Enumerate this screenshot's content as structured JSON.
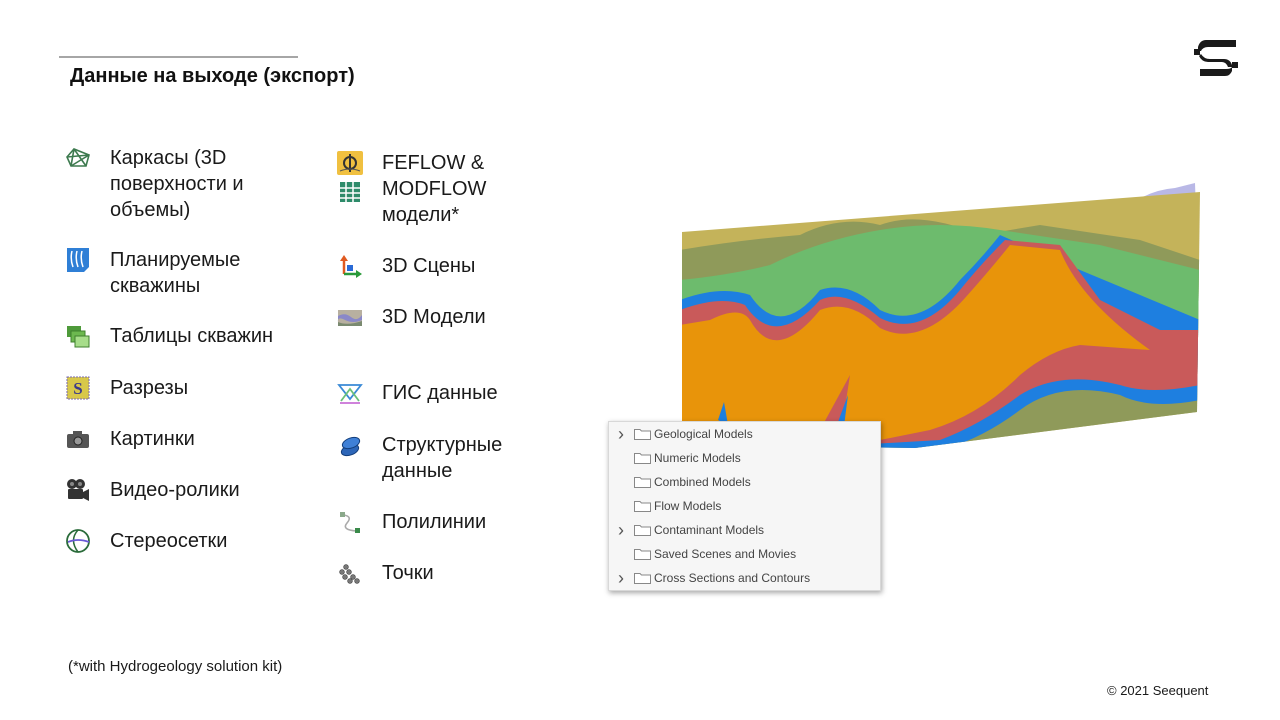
{
  "slide": {
    "title": "Данные на выходе (экспорт)",
    "footnote": "(*with Hydrogeology solution kit)",
    "copyright": "© 2021 Seequent",
    "logo": "seequent-logo"
  },
  "left_column": [
    {
      "icon": "wireframe-icon",
      "label": "Каркасы (3D\nповерхности и\nобъемы)"
    },
    {
      "icon": "planned-boreholes-icon",
      "label": "Планируемые\nскважины"
    },
    {
      "icon": "borehole-tables-icon",
      "label": "Таблицы скважин"
    },
    {
      "icon": "cross-sections-icon",
      "label": "Разрезы"
    },
    {
      "icon": "camera-icon",
      "label": "Картинки"
    },
    {
      "icon": "video-camera-icon",
      "label": "Видео-ролики"
    },
    {
      "icon": "stereonet-icon",
      "label": "Стереосетки"
    }
  ],
  "right_column": [
    {
      "icon": "feflow-modflow-icon",
      "label": "FEFLOW &\nMODFLOW\nмодели*"
    },
    {
      "icon": "3d-scene-axes-icon",
      "label": "3D Сцены"
    },
    {
      "icon": "3d-model-icon",
      "label": "3D Модели"
    },
    {
      "icon": "gis-data-icon",
      "label": "ГИС данные"
    },
    {
      "icon": "structural-data-icon",
      "label": "Структурные\nданные"
    },
    {
      "icon": "polyline-icon",
      "label": "Полилинии"
    },
    {
      "icon": "points-icon",
      "label": "Точки"
    }
  ],
  "project_tree": [
    {
      "label": "Geological Models",
      "expandable": true
    },
    {
      "label": "Numeric Models",
      "expandable": false
    },
    {
      "label": "Combined Models",
      "expandable": false
    },
    {
      "label": "Flow Models",
      "expandable": false
    },
    {
      "label": "Contaminant Models",
      "expandable": true
    },
    {
      "label": "Saved Scenes and Movies",
      "expandable": false
    },
    {
      "label": "Cross Sections and Contours",
      "expandable": true
    }
  ],
  "model_colors": {
    "orange": "#e8940a",
    "red": "#c95a5a",
    "blue": "#1e7fe0",
    "green": "#6dbb6d",
    "olive": "#8f9a5a",
    "khaki": "#c4b35a",
    "lavender": "#b9b8e6"
  }
}
